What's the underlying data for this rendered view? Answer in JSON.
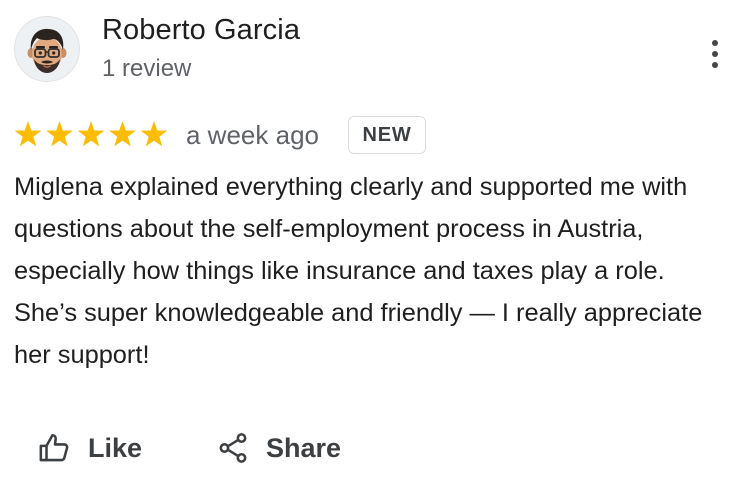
{
  "review": {
    "author": {
      "name": "Roberto Garcia",
      "meta": "1 review",
      "avatar_icon": "memoji-avatar"
    },
    "rating": 5,
    "max_rating": 5,
    "star_color": "#fbbc04",
    "time_ago": "a week ago",
    "badge": "NEW",
    "text": "Miglena explained everything clearly and supported me with questions about the self-employment process in Austria, especially how things like insurance and taxes play a role. She’s super knowledgeable and friendly — I really appreciate her support!"
  },
  "actions": {
    "like_label": "Like",
    "like_icon": "thumbs-up-icon",
    "share_label": "Share",
    "share_icon": "share-icon"
  },
  "menu": {
    "icon": "more-vert-icon"
  }
}
